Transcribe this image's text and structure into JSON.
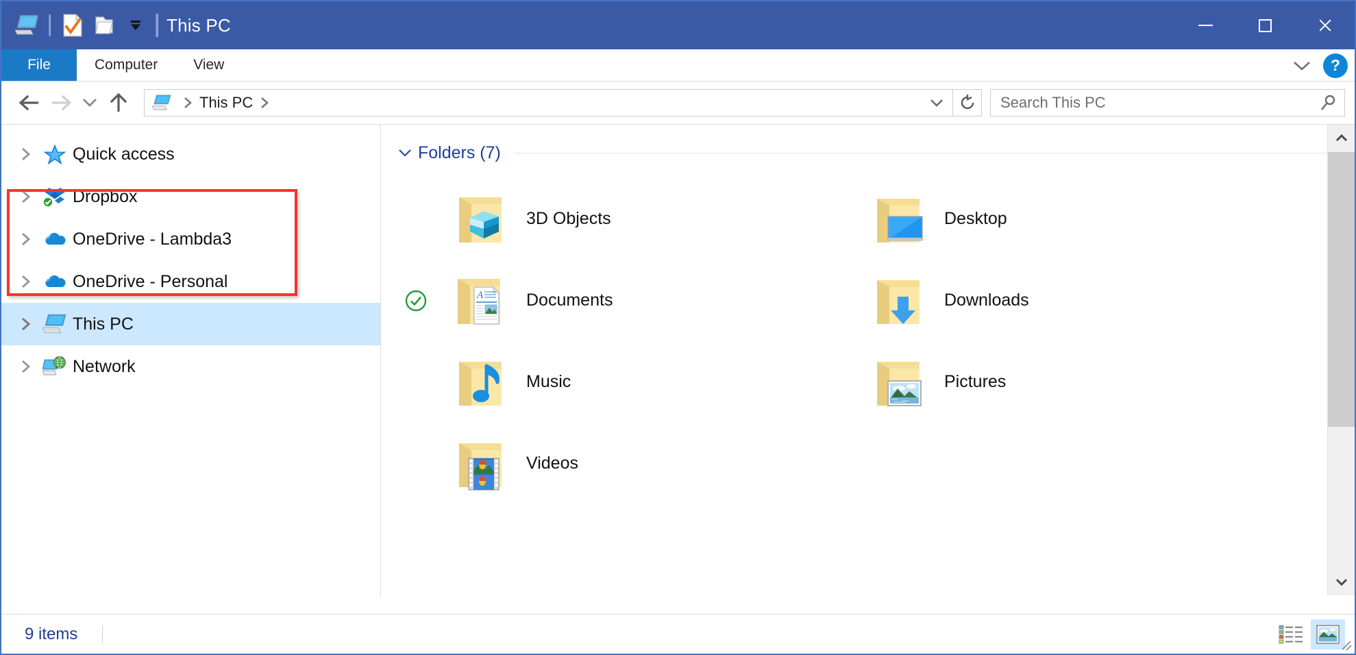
{
  "window": {
    "title": "This PC",
    "quick_access_toolbar": [
      {
        "name": "properties-icon",
        "label": "Properties"
      },
      {
        "name": "new-folder-icon",
        "label": "New folder"
      },
      {
        "name": "customize-quick-access-icon",
        "label": "Customize Quick Access Toolbar"
      }
    ],
    "controls": {
      "minimize": "Minimize",
      "maximize": "Maximize",
      "close": "Close"
    },
    "titlebar_color": "#3b5aa6",
    "border_color": "#4472c4"
  },
  "ribbon": {
    "tabs": [
      {
        "label": "File",
        "active": true
      },
      {
        "label": "Computer",
        "active": false
      },
      {
        "label": "View",
        "active": false
      }
    ],
    "expand_label": "Expand the Ribbon",
    "help_label": "?",
    "file_tab_color": "#1b7ac6",
    "help_color": "#0d86d8"
  },
  "addressbar": {
    "back": "Back",
    "forward": "Forward",
    "recent": "Recent locations",
    "up": "Up to Parent",
    "breadcrumbs": [
      {
        "label": "This PC",
        "icon": "this-pc-icon"
      }
    ],
    "dropdown": "Previous Locations",
    "refresh": "Refresh",
    "search": {
      "value": "",
      "placeholder": "Search This PC"
    }
  },
  "navpane": {
    "items": [
      {
        "label": "Quick access",
        "icon": "star-icon",
        "selected": false,
        "expanded": false
      },
      {
        "label": "Dropbox",
        "icon": "dropbox-icon",
        "selected": false,
        "expanded": false,
        "badge": "sync-ok-badge"
      },
      {
        "label": "OneDrive - Lambda3",
        "icon": "onedrive-cloud-icon",
        "selected": false,
        "expanded": false,
        "highlighted": true
      },
      {
        "label": "OneDrive - Personal",
        "icon": "onedrive-cloud-icon",
        "selected": false,
        "expanded": false,
        "highlighted": true
      },
      {
        "label": "This PC",
        "icon": "this-pc-icon",
        "selected": true,
        "expanded": false
      },
      {
        "label": "Network",
        "icon": "network-icon",
        "selected": false,
        "expanded": false
      }
    ],
    "annotation": {
      "color": "#f4352e",
      "covers": [
        "OneDrive - Lambda3",
        "OneDrive - Personal"
      ]
    }
  },
  "content": {
    "group": {
      "label": "Folders (7)",
      "expanded": true,
      "color": "#1f3f94"
    },
    "items": [
      {
        "label": "3D Objects",
        "icon": "folder-3d-objects-icon",
        "badge": ""
      },
      {
        "label": "Desktop",
        "icon": "folder-desktop-icon",
        "badge": ""
      },
      {
        "label": "Documents",
        "icon": "folder-documents-icon",
        "badge": "sync-available-badge"
      },
      {
        "label": "Downloads",
        "icon": "folder-downloads-icon",
        "badge": ""
      },
      {
        "label": "Music",
        "icon": "folder-music-icon",
        "badge": ""
      },
      {
        "label": "Pictures",
        "icon": "folder-pictures-icon",
        "badge": ""
      },
      {
        "label": "Videos",
        "icon": "folder-videos-icon",
        "badge": ""
      }
    ]
  },
  "statusbar": {
    "item_count": "9 items",
    "views": [
      {
        "name": "details-view-button",
        "label": "Details view",
        "active": false
      },
      {
        "name": "large-icons-view-button",
        "label": "Large icons view",
        "active": true
      }
    ]
  },
  "scrollbar": {
    "up": "Scroll up",
    "down": "Scroll down",
    "thumb_fraction": "0.66"
  }
}
